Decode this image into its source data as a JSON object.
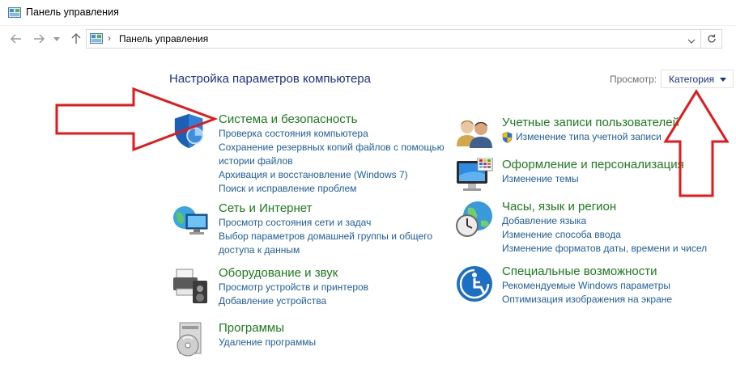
{
  "window": {
    "title": "Панель управления"
  },
  "address": {
    "crumb": "Панель управления",
    "separator": "›"
  },
  "header": {
    "title": "Настройка параметров компьютера",
    "view_label": "Просмотр:",
    "view_value": "Категория"
  },
  "left": [
    {
      "heading": "Система и безопасность",
      "icon": "shield-icon",
      "links": [
        "Проверка состояния компьютера",
        "Сохранение резервных копий файлов с помощью",
        "истории файлов",
        "Архивация и восстановление (Windows 7)",
        "Поиск и исправление проблем"
      ]
    },
    {
      "heading": "Сеть и Интернет",
      "icon": "network-globe-icon",
      "links": [
        "Просмотр состояния сети и задач",
        "Выбор параметров домашней группы и общего",
        "доступа к данным"
      ]
    },
    {
      "heading": "Оборудование и звук",
      "icon": "printer-speaker-icon",
      "links": [
        "Просмотр устройств и принтеров",
        "Добавление устройства"
      ]
    },
    {
      "heading": "Программы",
      "icon": "programs-disc-icon",
      "links": [
        "Удаление программы"
      ]
    }
  ],
  "right": [
    {
      "heading": "Учетные записи пользователей",
      "icon": "users-icon",
      "links": [
        "Изменение типа учетной записи"
      ]
    },
    {
      "heading": "Оформление и персонализация",
      "icon": "monitor-palette-icon",
      "links": [
        "Изменение темы"
      ]
    },
    {
      "heading": "Часы, язык и регион",
      "icon": "clock-globe-icon",
      "links": [
        "Добавление языка",
        "Изменение способа ввода",
        "Изменение форматов даты, времени и чисел"
      ]
    },
    {
      "heading": "Специальные возможности",
      "icon": "accessibility-icon",
      "links": [
        "Рекомендуемые Windows параметры",
        "Оптимизация изображения на экране"
      ]
    }
  ],
  "colors": {
    "heading_green": "#1e7d1e",
    "link_blue": "#1f5fa8",
    "title_blue": "#1e3287",
    "annotation_red": "#e3191c"
  }
}
